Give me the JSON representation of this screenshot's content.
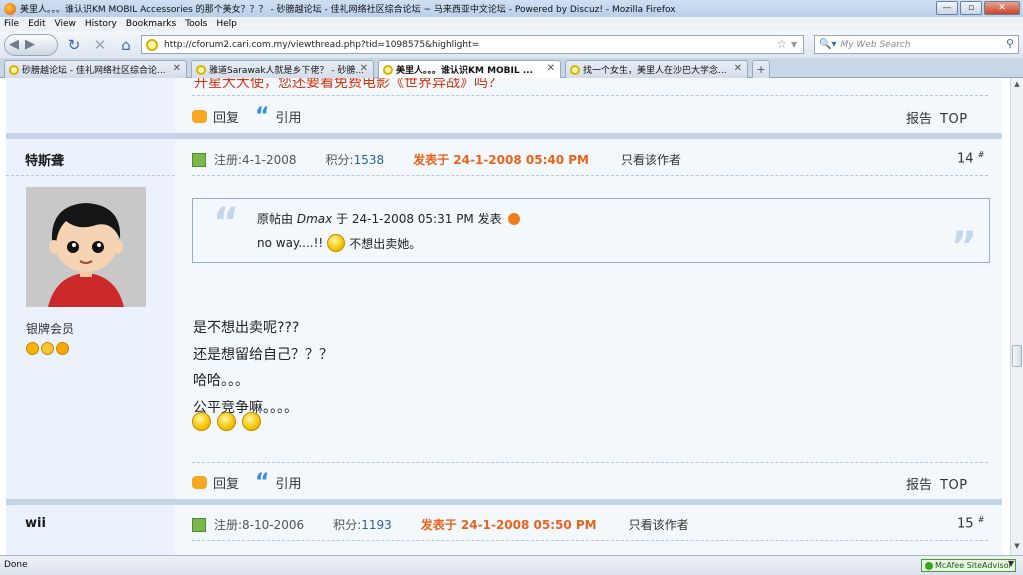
{
  "window": {
    "title": "美里人。。。谁认识KM MOBIL Accessories 的那个美女？？？ - 砂膀越论坛 - 佳礼网络社区综合论坛 ~ 马来西亚中文论坛 - Powered by Discuz! - Mozilla Firefox",
    "minimize": "—",
    "maximize": "▫",
    "close": "✕"
  },
  "menu": [
    "File",
    "Edit",
    "View",
    "History",
    "Bookmarks",
    "Tools",
    "Help"
  ],
  "nav": {
    "url": "http://cforum2.cari.com.my/viewthread.php?tid=1098575&highlight=",
    "search_placeholder": "My Web Search"
  },
  "tabs": [
    {
      "label": "砂膀越论坛 - 佳礼网络社区综合论..."
    },
    {
      "label": "雅道Sarawak人就是乡下佬？ - 砂膀..."
    },
    {
      "label": "美里人。。。谁认识KM MOBIL ..."
    },
    {
      "label": "找一个女生，美里人在沙巴大学念..."
    }
  ],
  "active_tab_index": 2,
  "post_prev": {
    "highlight_text": "开星大大使，您还要看免费电影《世界异战》吗？",
    "reply": "回复",
    "quote": "引用",
    "report": "报告",
    "top": "TOP"
  },
  "post14": {
    "username": "特斯聋",
    "rank": "银牌会员",
    "registered": "注册:4-1-2008",
    "points_label": "积分:",
    "points": "1538",
    "posted": "发表于 24-1-2008 05:40 PM",
    "only_author": "只看该作者",
    "floor": "14",
    "floor_sup": "#",
    "quote": {
      "prefix": "原帖由",
      "author": "Dmax",
      "suffix": "于 24-1-2008 05:31 PM 发表",
      "line2_a": "no way....!!",
      "line2_b": "不想出卖她。"
    },
    "body": [
      "是不想出卖呢???",
      "还是想留给自己？？？",
      "哈哈。。。",
      "公平竞争嘛。。。。"
    ],
    "reply": "回复",
    "quote_btn": "引用",
    "report": "报告",
    "top": "TOP"
  },
  "post15": {
    "username": "wii",
    "registered": "注册:8-10-2006",
    "points_label": "积分:",
    "points": "1193",
    "posted": "发表于 24-1-2008 05:50 PM",
    "only_author": "只看该作者",
    "floor": "15",
    "floor_sup": "#"
  },
  "status": {
    "text": "Done",
    "mcafee": "McAfee SiteAdvisor"
  },
  "colors": {
    "accent_orange": "#e9641b",
    "link_blue": "#2b5fa3",
    "panel_blue": "#ebf2fb"
  }
}
